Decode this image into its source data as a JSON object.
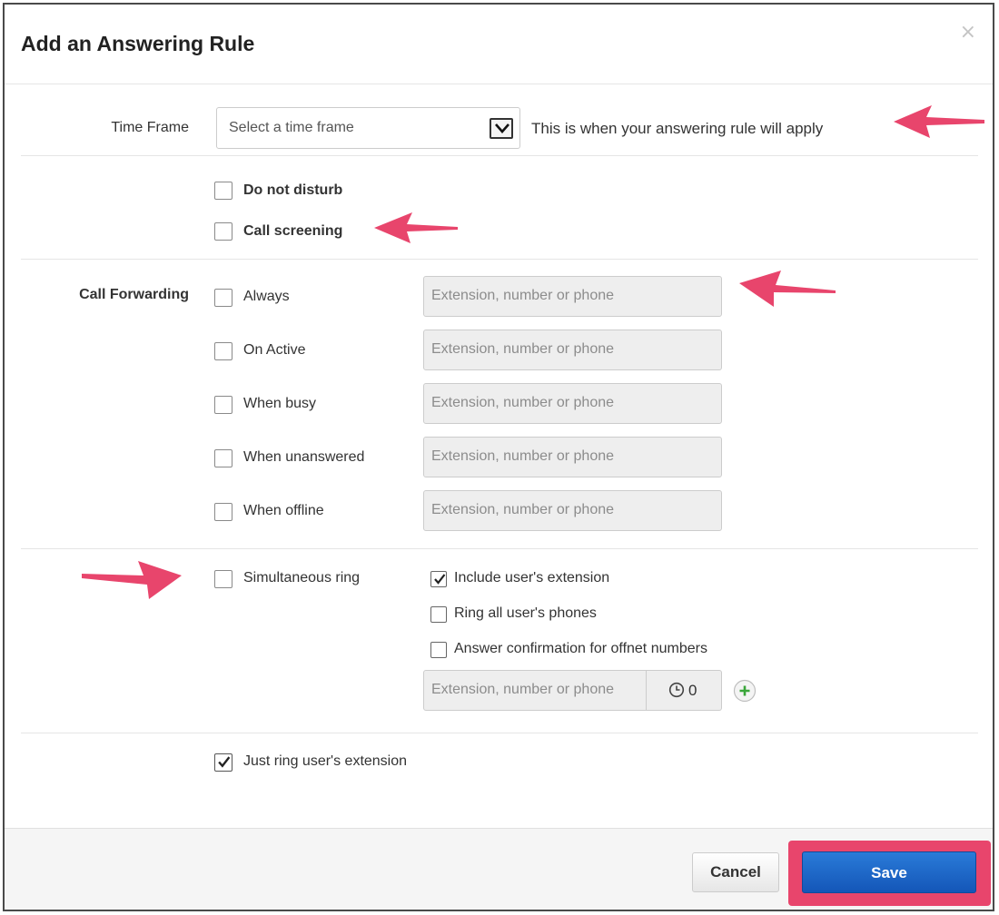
{
  "dialog": {
    "title": "Add an Answering Rule",
    "close_symbol": "×"
  },
  "time_frame": {
    "label": "Time Frame",
    "selected": "Select a time frame",
    "help_text": "This is when your answering rule will apply"
  },
  "options": {
    "do_not_disturb": {
      "label": "Do not disturb",
      "checked": false
    },
    "call_screening": {
      "label": "Call screening",
      "checked": false
    }
  },
  "call_forwarding": {
    "label": "Call Forwarding",
    "placeholder": "Extension, number or phone",
    "rows": [
      {
        "label": "Always",
        "checked": false
      },
      {
        "label": "On Active",
        "checked": false
      },
      {
        "label": "When busy",
        "checked": false
      },
      {
        "label": "When unanswered",
        "checked": false
      },
      {
        "label": "When offline",
        "checked": false
      }
    ]
  },
  "simultaneous_ring": {
    "label": "Simultaneous ring",
    "checked": false,
    "sub_options": [
      {
        "label": "Include user's extension",
        "checked": true
      },
      {
        "label": "Ring all user's phones",
        "checked": false
      },
      {
        "label": "Answer confirmation for offnet numbers",
        "checked": false
      }
    ],
    "placeholder": "Extension, number or phone",
    "delay_value": "0"
  },
  "just_ring": {
    "label": "Just ring user's extension",
    "checked": true
  },
  "footer": {
    "cancel_label": "Cancel",
    "save_label": "Save"
  },
  "colors": {
    "annotation_pink": "#e8456c",
    "save_blue": "#1f69c9",
    "plus_green": "#3aa63a"
  },
  "icons": [
    "close-icon",
    "chevron-down-icon",
    "checkmark-icon",
    "clock-icon",
    "plus-circle-icon",
    "arrow-annotation"
  ]
}
